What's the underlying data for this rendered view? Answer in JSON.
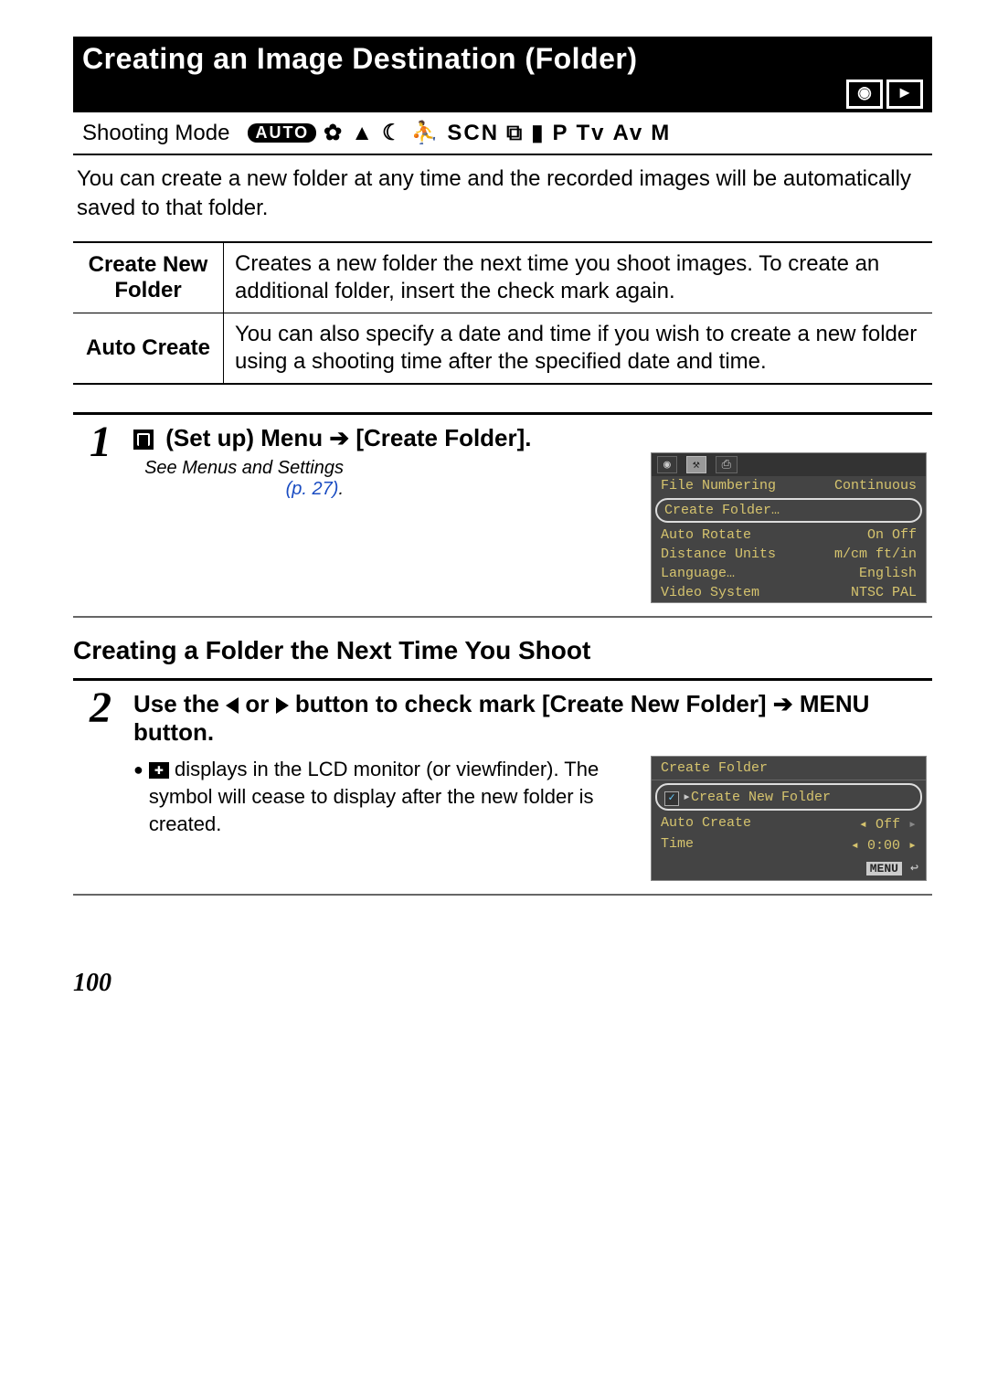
{
  "title": "Creating an Image Destination (Folder)",
  "title_icons": {
    "camera": "📷",
    "play": "►"
  },
  "mode_label": "Shooting Mode",
  "mode_icons": {
    "auto": "AUTO",
    "scn": "SCN",
    "p": "P",
    "tv": "Tv",
    "av": "Av",
    "m": "M"
  },
  "intro": "You can create a new folder at any time and the recorded images will be automatically saved to that folder.",
  "defs": [
    {
      "label": "Create New Folder",
      "desc": "Creates a new folder the next time you shoot images. To create an additional folder, insert the check mark again."
    },
    {
      "label": "Auto Create",
      "desc": "You can also specify a date and time if you wish to create a new folder using a shooting time after the specified date and time."
    }
  ],
  "step1": {
    "num": "1",
    "text_a": "(Set up) Menu",
    "text_b": "[Create Folder].",
    "ref_a": "See Menus and Settings ",
    "ref_b": "(p. 27)",
    "ref_c": "."
  },
  "lcd1": {
    "rows": [
      {
        "l": "File Numbering",
        "r": "Continuous",
        "dim": true
      },
      {
        "sel": "Create Folder…"
      },
      {
        "l": "Auto Rotate",
        "r": "On  Off",
        "dim": true
      },
      {
        "l": "Distance Units",
        "r": "m/cm  ft/in"
      },
      {
        "l": "Language…",
        "r": "English"
      },
      {
        "l": "Video System",
        "r": "NTSC  PAL"
      }
    ]
  },
  "subsection": "Creating a Folder the Next Time You Shoot",
  "step2": {
    "num": "2",
    "text_a": "Use the ",
    "text_b": " or ",
    "text_c": " button to check mark [Create New Folder] ",
    "text_d": " MENU button.",
    "bullet": " displays in the LCD monitor (or viewfinder). The symbol will cease to display after the new folder is created."
  },
  "lcd2": {
    "title": "Create Folder",
    "rows": [
      {
        "check": true,
        "l": "Create New Folder"
      },
      {
        "l": "Auto Create",
        "r": "Off"
      },
      {
        "l": "Time",
        "r": "0:00",
        "dim": true
      }
    ],
    "menu": "MENU"
  },
  "page_num": "100"
}
